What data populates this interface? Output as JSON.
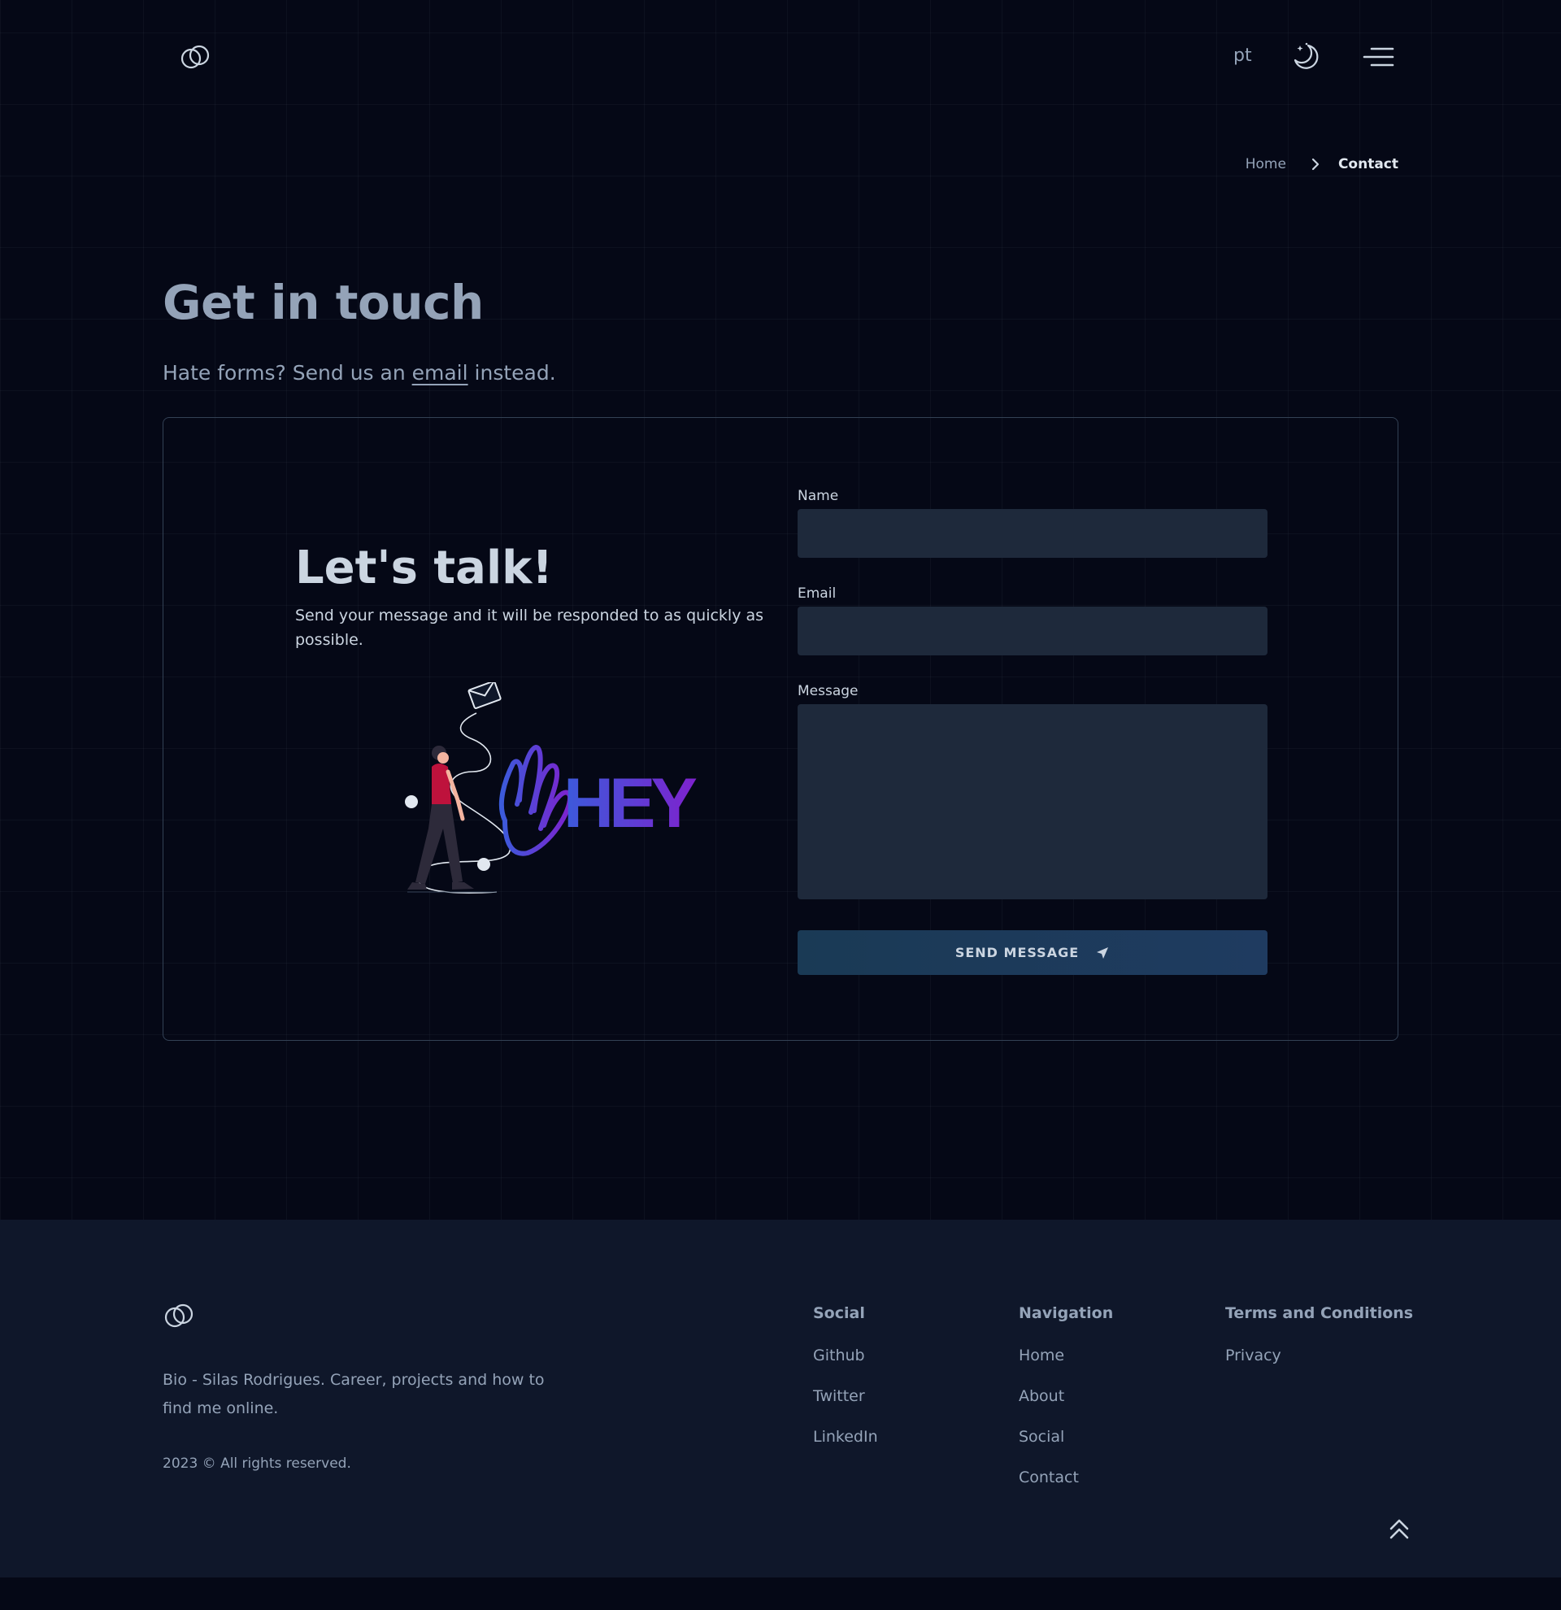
{
  "header": {
    "logo_icon": "linked-rings-logo-icon",
    "lang_label": "pt",
    "theme_icon": "moon-stars-icon",
    "menu_icon": "hamburger-menu-icon"
  },
  "breadcrumb": {
    "home": "Home",
    "separator_icon": "chevron-right-icon",
    "current": "Contact"
  },
  "main": {
    "title": "Get in touch",
    "subtitle_before": "Hate forms? Send us an ",
    "subtitle_link": "email",
    "subtitle_after": " instead."
  },
  "card": {
    "title": "Let's talk!",
    "description": "Send your message and it will be responded to as quickly as possible.",
    "illustration_text": "HEY",
    "form": {
      "name_label": "Name",
      "name_value": "",
      "email_label": "Email",
      "email_value": "",
      "message_label": "Message",
      "message_value": "",
      "send_label": "SEND MESSAGE",
      "send_icon": "paper-plane-icon"
    }
  },
  "footer": {
    "bio": "Bio - Silas Rodrigues. Career, projects and how to find me online.",
    "copyright": "2023 © All rights reserved.",
    "social": {
      "heading": "Social",
      "links": [
        "Github",
        "Twitter",
        "LinkedIn"
      ]
    },
    "navigation": {
      "heading": "Navigation",
      "links": [
        "Home",
        "About",
        "Social",
        "Contact"
      ]
    },
    "terms": {
      "heading": "Terms and Conditions",
      "links": [
        "Privacy"
      ]
    },
    "back_to_top_icon": "double-chevron-up-icon"
  },
  "colors": {
    "background": "#050816",
    "footer_bg": "#0f172a",
    "input_bg": "#1e293b",
    "accent_purple": "#7e22ce",
    "accent_blue": "#3b5bdb",
    "figure_shirt": "#be123c"
  }
}
